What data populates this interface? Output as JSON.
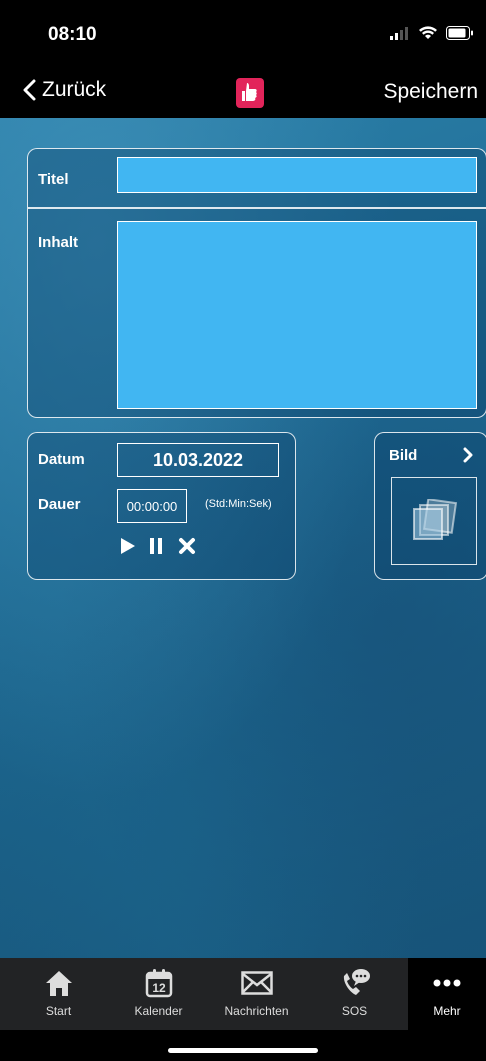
{
  "status": {
    "time": "08:10"
  },
  "nav": {
    "back_label": "Zurück",
    "save_label": "Speichern"
  },
  "form": {
    "title_label": "Titel",
    "title_value": "",
    "content_label": "Inhalt",
    "content_value": "",
    "date_label": "Datum",
    "date_value": "10.03.2022",
    "duration_label": "Dauer",
    "duration_value": "00:00:00",
    "duration_hint": "(Std:Min:Sek)"
  },
  "image": {
    "label": "Bild"
  },
  "tabs": [
    {
      "label": "Start",
      "icon": "home-icon"
    },
    {
      "label": "Kalender",
      "icon": "calendar-icon",
      "badge": "12"
    },
    {
      "label": "Nachrichten",
      "icon": "mail-icon"
    },
    {
      "label": "SOS",
      "icon": "phone-icon"
    },
    {
      "label": "Mehr",
      "icon": "more-icon",
      "active": true
    }
  ],
  "colors": {
    "field": "#41b6f2",
    "logo": "#e2245a",
    "tabbar": "#222325"
  }
}
